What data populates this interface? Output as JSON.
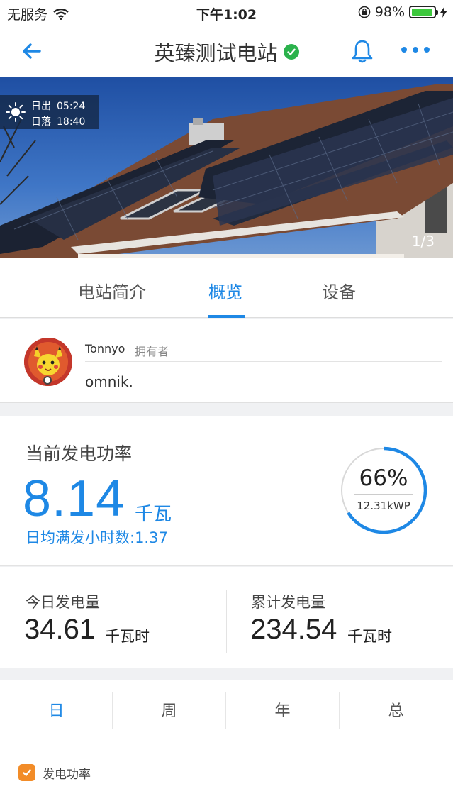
{
  "status_bar": {
    "carrier": "无服务",
    "time": "下午1:02",
    "battery": "98%"
  },
  "nav": {
    "title": "英臻测试电站"
  },
  "hero": {
    "sunrise_label": "日出",
    "sunrise_time": "05:24",
    "sunset_label": "日落",
    "sunset_time": "18:40",
    "page_indicator": "1/3"
  },
  "tabs": [
    {
      "label": "电站简介"
    },
    {
      "label": "概览"
    },
    {
      "label": "设备"
    }
  ],
  "owner": {
    "name": "Tonnyo",
    "role": "拥有者",
    "description": "omnik."
  },
  "power": {
    "label": "当前发电功率",
    "value": "8.14",
    "unit": "千瓦",
    "full_hours": "日均满发小时数:1.37",
    "percent_text": "66%",
    "percent": 0.66,
    "capacity": "12.31kWP"
  },
  "energy": {
    "today_label": "今日发电量",
    "today_value": "34.61",
    "today_unit": "千瓦时",
    "total_label": "累计发电量",
    "total_value": "234.54",
    "total_unit": "千瓦时"
  },
  "periods": [
    {
      "label": "日"
    },
    {
      "label": "周"
    },
    {
      "label": "年"
    },
    {
      "label": "总"
    }
  ],
  "legend": {
    "label": "发电功率"
  },
  "colors": {
    "accent": "#1e88e5",
    "check": "#f28c28",
    "verified": "#2bb24c"
  }
}
